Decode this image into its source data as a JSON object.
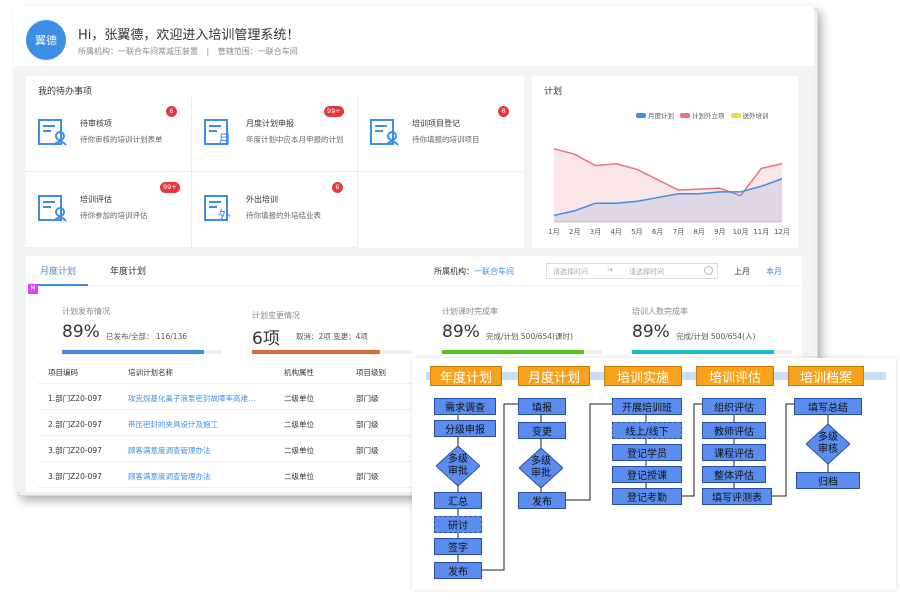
{
  "header": {
    "avatar": "翼德",
    "greeting": "Hi，张翼德，欢迎进入培训管理系统！",
    "org": "所属机构：一联合车间常减压装置",
    "divider": "|",
    "scope": "管辖范围：一联合车间"
  },
  "todo": {
    "title": "我的待办事项",
    "items": [
      {
        "name": "待审核项",
        "desc": "待你审核的培训计划表单",
        "badge": "6"
      },
      {
        "name": "月度计划申报",
        "desc": "年度计划中应本月申报的计划",
        "badge": "99+"
      },
      {
        "name": "培训项目登记",
        "desc": "待你填报的培训项目",
        "badge": "6"
      },
      {
        "name": "培训评估",
        "desc": "待你参加的培训评估",
        "badge": "99+"
      },
      {
        "name": "外出培训",
        "desc": "待你填报的外培结业表",
        "badge": "6"
      }
    ]
  },
  "plan_chart": {
    "title": "计划",
    "legend": [
      "月度计划",
      "计划外立项",
      "送外培训"
    ],
    "colors": {
      "monthly": "#3c8ee6",
      "unplanned": "#e8737a",
      "external": "#f5d24a"
    }
  },
  "chart_data": {
    "type": "area",
    "categories": [
      "1月",
      "2月",
      "3月",
      "4月",
      "5月",
      "6月",
      "7月",
      "8月",
      "9月",
      "10月",
      "11月",
      "12月"
    ],
    "series": [
      {
        "name": "计划外立项",
        "values": [
          78,
          72,
          60,
          62,
          56,
          45,
          34,
          35,
          36,
          28,
          57,
          62
        ]
      },
      {
        "name": "月度计划",
        "values": [
          7,
          12,
          20,
          20,
          22,
          26,
          30,
          30,
          32,
          32,
          38,
          46
        ]
      },
      {
        "name": "送外培训",
        "values": [
          0,
          0,
          0,
          0,
          0,
          0,
          0,
          0,
          0,
          0,
          0,
          0
        ]
      }
    ],
    "ylim": [
      0,
      100
    ]
  },
  "tabs": {
    "monthly": "月度计划",
    "yearly": "年度计划",
    "org_label": "所属机构：",
    "org_value": "一联合车间",
    "start_placeholder": "请选择时间",
    "end_placeholder": "请选择时间",
    "range_arrow": "→",
    "prev_month": "上月",
    "this_month": "本月"
  },
  "marker": "M",
  "stats": [
    {
      "label": "计划发布情况",
      "big": "89%",
      "detail": "已发布/全部： 116/136",
      "progress": 0.89,
      "color": "#3c8ee6"
    },
    {
      "label": "计划变更情况",
      "big": "6项",
      "detail": "取消：2项 变更：4项",
      "progress": 0.8,
      "color": "#e6683c"
    },
    {
      "label": "计划课时完成率",
      "big": "89%",
      "detail": "完成/计划 500/654(课时)",
      "progress": 0.89,
      "color": "#52c41a"
    },
    {
      "label": "培训人数完成率",
      "big": "89%",
      "detail": "完成/计划 500/654(人)",
      "progress": 0.89,
      "color": "#1bbcc4"
    }
  ],
  "table": {
    "headers": [
      "项目编码",
      "培训计划名称",
      "机构属性",
      "项目级别"
    ],
    "rows": [
      [
        "1.部门Z20-097",
        "攻克烷基化离子液泵密封故障率高难…",
        "二级单位",
        "部门级"
      ],
      [
        "2.部门Z20-097",
        "带压密封的夹具设计及施工",
        "二级单位",
        "部门级"
      ],
      [
        "3.部门Z20-097",
        "顾客满意度调查管理办法",
        "二级单位",
        "部门级"
      ],
      [
        "3.部门Z20-097",
        "顾客满意度调查管理办法",
        "二级单位",
        "部门级"
      ]
    ]
  },
  "flow": {
    "stages": [
      "年度计划",
      "月度计划",
      "培训实施",
      "培训评估",
      "培训档案"
    ],
    "col1": [
      "需求调查",
      "分级申报",
      "汇总",
      "研讨",
      "签字",
      "发布"
    ],
    "col1_diamond": "多级\n审批",
    "col2": [
      "填报",
      "变更",
      "发布"
    ],
    "col2_diamond": "多级\n审批",
    "col3": [
      "开展培训班",
      "线上/线下",
      "登记学员",
      "登记授课",
      "登记考勤"
    ],
    "col4": [
      "组织评估",
      "教师评估",
      "课程评估",
      "整体评估",
      "填写评测表"
    ],
    "col5": [
      "填写总结",
      "归档"
    ],
    "col5_diamond": "多级\n审核"
  }
}
